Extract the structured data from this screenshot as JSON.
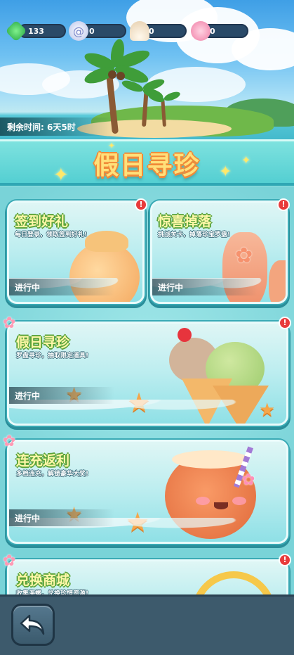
{
  "resources": [
    {
      "icon": "green-gem-icon",
      "value": "133",
      "color": "#3cc85a"
    },
    {
      "icon": "conch-shell-icon",
      "value": "0",
      "color": "#cfd6f0"
    },
    {
      "icon": "scallop-shell-icon",
      "value": "0",
      "color": "#f3e4cf"
    },
    {
      "icon": "pink-shell-icon",
      "value": "0",
      "color": "#f5a2c0"
    }
  ],
  "timer": {
    "label": "剩余时间:",
    "value": "6天5时"
  },
  "event_title": "假日寻珍",
  "cards": [
    {
      "title": "签到好礼",
      "subtitle": "每日登录，领取签到好礼!",
      "status": "进行中",
      "alert": "!"
    },
    {
      "title": "惊喜掉落",
      "subtitle": "挑战关卡，掉落珍宝罗盘!",
      "status": "进行中",
      "alert": "!"
    },
    {
      "title": "假日寻珍",
      "subtitle": "罗盘寻珍，抽取限定道具!",
      "status": "进行中",
      "alert": "!"
    },
    {
      "title": "连充返利",
      "subtitle": "多档连充，解锁豪华大奖!",
      "status": "进行中",
      "alert": ""
    },
    {
      "title": "兑换商城",
      "subtitle": "收集海螺，兑换珍惜资源!",
      "status": "",
      "alert": "!"
    }
  ],
  "footer": {
    "back_icon": "back-arrow-icon"
  },
  "colors": {
    "accent": "#54cfd2",
    "title_fill": "#ffe07a",
    "title_outline": "#f08a38",
    "card_title": "#fff7a8",
    "alert": "#e83b3b"
  }
}
